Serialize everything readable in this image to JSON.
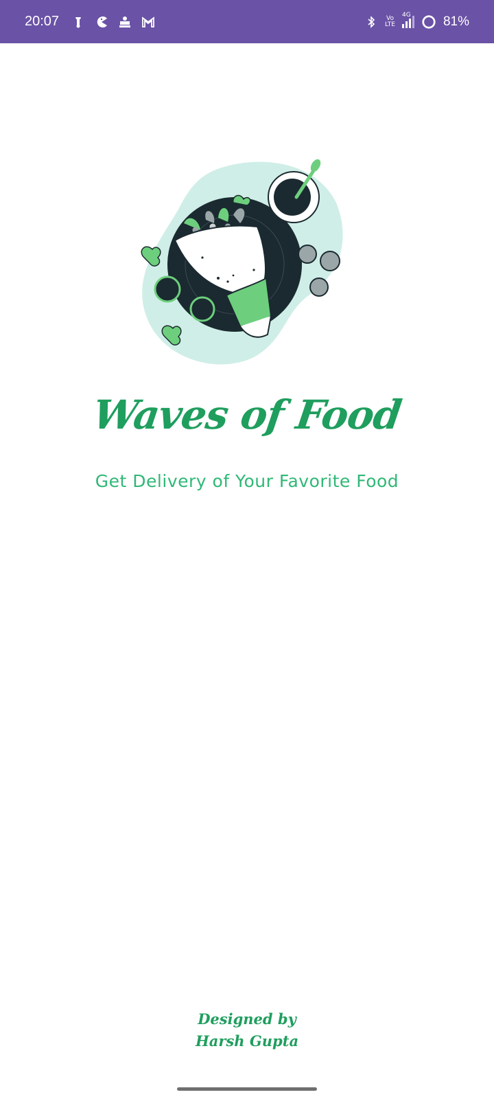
{
  "status_bar": {
    "time": "20:07",
    "battery": "81%",
    "network": "4G",
    "volte_top": "Vo",
    "volte_bottom": "LTE",
    "left_icons": [
      "scooter-notification-icon",
      "pac-notification-icon",
      "news-app-notification-icon",
      "gmail-icon"
    ],
    "right_icons": [
      "bluetooth-icon",
      "volte-icon",
      "signal-icon",
      "battery-ring-icon"
    ]
  },
  "app": {
    "title": "Waves of Food",
    "tagline": "Get Delivery of Your Favorite Food",
    "credit_line1": "Designed by",
    "credit_line2": "Harsh Gupta"
  },
  "colors": {
    "status_bar": "#6a52a6",
    "brand_green": "#1f9e5e",
    "accent_green": "#6dcf7d",
    "dark_plate": "#1b2a30",
    "mint_blob": "#cfeee7"
  }
}
